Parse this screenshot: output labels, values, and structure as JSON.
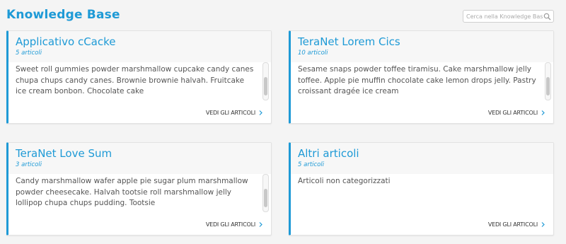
{
  "header": {
    "title": "Knowledge Base",
    "search_placeholder": "Cerca nella Knowledge Base"
  },
  "cards": [
    {
      "title": "Applicativo cCacke",
      "count": "5 articoli",
      "description": "Sweet roll gummies powder marshmallow cupcake candy canes chupa chups candy canes. Brownie brownie halvah. Fruitcake ice cream bonbon. Chocolate cake",
      "link": "VEDI GLI ARTICOLI"
    },
    {
      "title": "TeraNet Lorem Cics",
      "count": "10 articoli",
      "description": "Sesame snaps powder toffee tiramisu. Cake marshmallow jelly toffee. Apple pie muffin chocolate cake lemon drops jelly. Pastry croissant dragée ice cream",
      "link": "VEDI GLI ARTICOLI"
    },
    {
      "title": "TeraNet Love Sum",
      "count": "3 articoli",
      "description": "Candy marshmallow wafer apple pie sugar plum marshmallow powder cheesecake. Halvah tootsie roll marshmallow jelly lollipop chupa chups pudding. Tootsie",
      "link": "VEDI GLI ARTICOLI"
    },
    {
      "title": "Altri articoli",
      "count": "5 articoli",
      "description": "Articoli non categorizzati",
      "link": "VEDI GLI ARTICOLI"
    }
  ],
  "colors": {
    "accent": "#1e9ad6",
    "background": "#f4f4f4"
  },
  "icons": {
    "search": "search-icon",
    "link": "chevron-right-icon"
  }
}
